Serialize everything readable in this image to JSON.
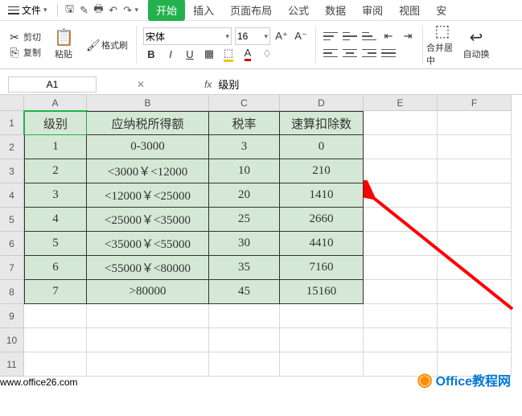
{
  "menu": {
    "file": "文件",
    "tabs": [
      "开始",
      "插入",
      "页面布局",
      "公式",
      "数据",
      "审阅",
      "视图",
      "安"
    ]
  },
  "ribbon": {
    "paste": "粘贴",
    "cut": "剪切",
    "copy": "复制",
    "format_painter": "格式刷",
    "font_name": "宋体",
    "font_size": "16",
    "merge": "合并居中",
    "autowrap": "自动换"
  },
  "formula_bar": {
    "cell_ref": "A1",
    "fx_label": "fx",
    "value": "级别"
  },
  "grid": {
    "cols": [
      "A",
      "B",
      "C",
      "D",
      "E",
      "F"
    ],
    "rownums": [
      "1",
      "2",
      "3",
      "4",
      "5",
      "6",
      "7",
      "8",
      "9",
      "10",
      "11"
    ],
    "headers": [
      "级别",
      "应纳税所得额",
      "税率",
      "速算扣除数"
    ],
    "data": [
      [
        "1",
        "0-3000",
        "3",
        "0"
      ],
      [
        "2",
        "<3000￥<12000",
        "10",
        "210"
      ],
      [
        "3",
        "<12000￥<25000",
        "20",
        "1410"
      ],
      [
        "4",
        "<25000￥<35000",
        "25",
        "2660"
      ],
      [
        "5",
        "<35000￥<55000",
        "30",
        "4410"
      ],
      [
        "6",
        "<55000￥<80000",
        "35",
        "7160"
      ],
      [
        "7",
        ">80000",
        "45",
        "15160"
      ]
    ]
  },
  "watermark": {
    "brand": "Office教程网",
    "url": "www.office26.com"
  },
  "chart_data": {
    "type": "table",
    "title": "",
    "columns": [
      "级别",
      "应纳税所得额",
      "税率",
      "速算扣除数"
    ],
    "rows": [
      [
        1,
        "0-3000",
        3,
        0
      ],
      [
        2,
        "<3000￥<12000",
        10,
        210
      ],
      [
        3,
        "<12000￥<25000",
        20,
        1410
      ],
      [
        4,
        "<25000￥<35000",
        25,
        2660
      ],
      [
        5,
        "<35000￥<55000",
        30,
        4410
      ],
      [
        6,
        "<55000￥<80000",
        35,
        7160
      ],
      [
        7,
        ">80000",
        45,
        15160
      ]
    ]
  }
}
